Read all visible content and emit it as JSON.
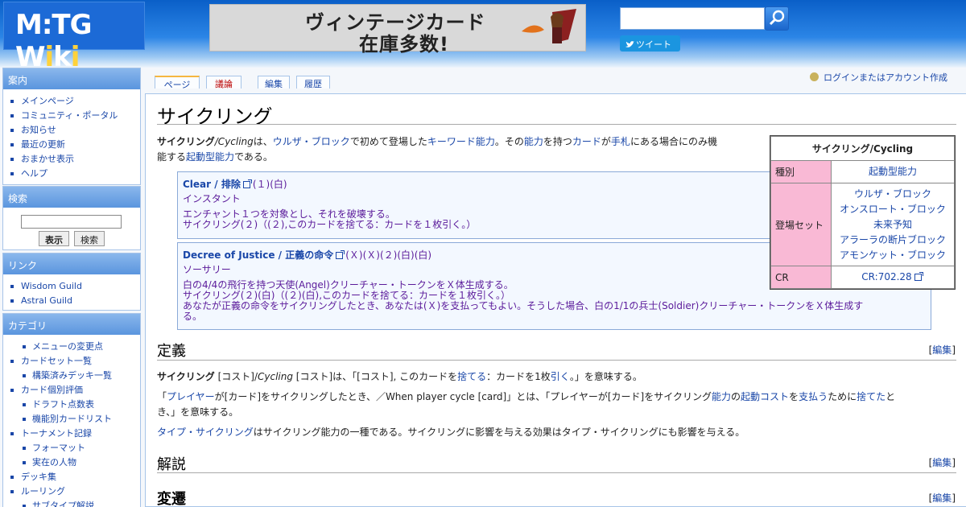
{
  "header": {
    "logo_a": "M:TG W",
    "logo_b": "i",
    "logo_c": "k",
    "logo_d": "i",
    "banner_line1": "ヴィンテージカード",
    "banner_line2": "在庫多数!",
    "tweet_label": "ツイート"
  },
  "sidebar": {
    "guide": {
      "title": "案内",
      "items": [
        "メインページ",
        "コミュニティ・ポータル",
        "お知らせ",
        "最近の更新",
        "おまかせ表示",
        "ヘルプ"
      ]
    },
    "search": {
      "title": "検索",
      "go": "表示",
      "search": "検索"
    },
    "links": {
      "title": "リンク",
      "items": [
        "Wisdom Guild",
        "Astral Guild"
      ]
    },
    "category": {
      "title": "カテゴリ",
      "items": [
        {
          "label": "メニューの変更点",
          "sub": true
        },
        {
          "label": "カードセット一覧",
          "sub": false
        },
        {
          "label": "構築済みデッキ一覧",
          "sub": true
        },
        {
          "label": "カード個別評価",
          "sub": false
        },
        {
          "label": "ドラフト点数表",
          "sub": true
        },
        {
          "label": "機能別カードリスト",
          "sub": true
        },
        {
          "label": "トーナメント記録",
          "sub": false
        },
        {
          "label": "フォーマット",
          "sub": true
        },
        {
          "label": "実在の人物",
          "sub": true
        },
        {
          "label": "デッキ集",
          "sub": false
        },
        {
          "label": "ルーリング",
          "sub": false
        },
        {
          "label": "サブタイプ解説",
          "sub": true
        }
      ]
    }
  },
  "tabs": {
    "page": "ページ",
    "talk": "議論",
    "edit": "編集",
    "history": "履歴"
  },
  "login": "ログインまたはアカウント作成",
  "article": {
    "title": "サイクリング",
    "intro": {
      "t1": "サイクリング",
      "t2": "/Cycling",
      "t3": "は、",
      "l1": "ウルザ・ブロック",
      "t4": "で初めて登場した",
      "l2": "キーワード能力",
      "t5": "。その",
      "l3": "能力",
      "t6": "を持つ",
      "l4": "カード",
      "t7": "が",
      "l5": "手札",
      "t8": "にある場合にのみ機",
      "t9": "能する",
      "l6": "起動型能力",
      "t10": "である。"
    },
    "card1": {
      "name": "Clear / 排除",
      "cost": "(１)(白)",
      "type": "インスタント",
      "text1": "エンチャント１つを対象とし、それを破壊する。",
      "text2": "サイクリング(２)（(２),このカードを捨てる：カードを１枚引く。）"
    },
    "card2": {
      "name": "Decree of Justice / 正義の命令",
      "cost": "(Ｘ)(Ｘ)(２)(白)(白)",
      "type": "ソーサリー",
      "text1": "白の4/4の飛行を持つ天使(Angel)クリーチャー・トークンをＸ体生成する。",
      "text2": "サイクリング(２)(白)（(２)(白),このカードを捨てる：カードを１枚引く。）",
      "text3": "あなたが正義の命令をサイクリングしたとき、あなたは(Ｘ)を支払ってもよい。そうした場合、白の1/1の兵士(Soldier)クリーチャー・トークンをＸ体生成す",
      "text4": "る。"
    },
    "sec_def": "定義",
    "def1": {
      "b": "サイクリング",
      "t1": " [コスト]/",
      "i": "Cycling",
      "t2": " [コスト]は、「[コスト], このカードを",
      "l1": "捨てる",
      "t3": "：カードを1枚",
      "l2": "引く",
      "t4": "。」を意味する。"
    },
    "def2": {
      "t1": "「",
      "l1": "プレイヤー",
      "t2": "が[カード]をサイクリングしたとき、／When player cycle [card]」とは、「プレイヤーが[カード]をサイクリング",
      "l2": "能力",
      "t3": "の",
      "l3": "起動コスト",
      "t4": "を",
      "l4": "支払う",
      "t5": "ために",
      "l5": "捨てた",
      "t6": "と",
      "t7": "き、」を意味する。"
    },
    "def3": {
      "l1": "タイプ・サイクリング",
      "t1": "はサイクリング能力の一種である。サイクリングに影響を与える効果はタイプ・サイクリングにも影響を与える。"
    },
    "sec_expl": "解説",
    "sec_hist": "変遷",
    "edit_open": "[",
    "edit_label": "編集",
    "edit_close": "]"
  },
  "infobox": {
    "caption": "サイクリング/Cycling",
    "type_label": "種別",
    "type_value": "起動型能力",
    "sets_label": "登場セット",
    "sets": [
      "ウルザ・ブロック",
      "オンスロート・ブロック",
      "未来予知",
      "アラーラの断片ブロック",
      "アモンケット・ブロック"
    ],
    "cr_label": "CR",
    "cr_value": "CR:702.28"
  }
}
